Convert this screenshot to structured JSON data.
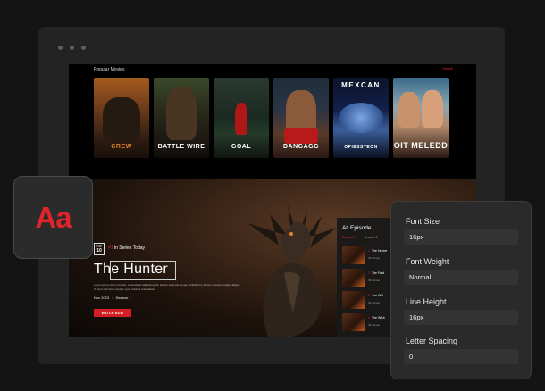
{
  "popular": {
    "title": "Popular Movies",
    "view_all": "View All",
    "posters": [
      {
        "title": "CREW",
        "top": ""
      },
      {
        "title": "BATTLE WIRE",
        "top": ""
      },
      {
        "title": "GOAL",
        "top": ""
      },
      {
        "title": "DANGAGG",
        "top": ""
      },
      {
        "title": "OPIESSTEON",
        "top": "MEXCAN"
      },
      {
        "title": "OIT MELEDD",
        "top": ""
      }
    ]
  },
  "hero": {
    "badge_top": "TOP",
    "badge_num": "10",
    "rank_hi": "#1",
    "rank_text": " in Series Today",
    "title": "The Hunter",
    "description": "Lorem ipsum dolor sit amet, consectetur adipiscing elit, sed do eiusmod tempor incididunt ut labore et dolore magna aliqua. Ut enim ad minim veniam, quis nostrud exercitation.",
    "year": "Nov 2023",
    "season": "Season 1",
    "watch_label": "WATCH NOW"
  },
  "episodes": {
    "title": "All Episode",
    "tabs": [
      "Season 1",
      "Season 2"
    ],
    "items": [
      {
        "num": "1",
        "name": "The Hunter",
        "duration": "45 minute"
      },
      {
        "num": "2",
        "name": "The Past",
        "duration": "45 minute"
      },
      {
        "num": "3",
        "name": "You Will",
        "duration": "45 minute"
      },
      {
        "num": "4",
        "name": "The Wish",
        "duration": "45 minute"
      }
    ]
  },
  "aa_label": "Aa",
  "typography": {
    "font_size_label": "Font Size",
    "font_size_value": "16px",
    "font_weight_label": "Font Weight",
    "font_weight_value": "Normal",
    "line_height_label": "Line Height",
    "line_height_value": "16px",
    "letter_spacing_label": "Letter Spacing",
    "letter_spacing_value": "0"
  },
  "colors": {
    "accent": "#e0242b",
    "background": "#141414",
    "panel": "#2a2a2a"
  }
}
